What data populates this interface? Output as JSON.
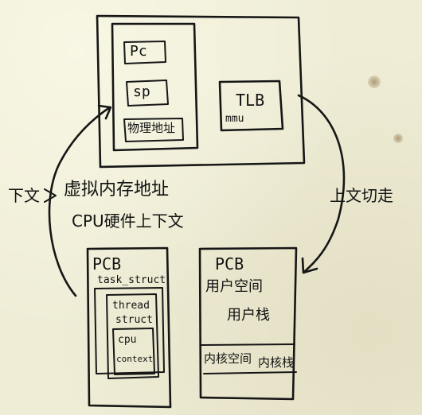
{
  "cpu_box": {
    "register_pc": "Pc",
    "register_sp": "sp",
    "register_phys": "物理地址",
    "tlb": "TLB",
    "mmu": "mmu"
  },
  "left_annotation": {
    "side_label": "下文",
    "line1": "虚拟内存地址",
    "line2": "CPU硬件上下文"
  },
  "right_annotation": {
    "label": "上文切走"
  },
  "pcb_left": {
    "title": "PCB",
    "task_struct": "task_struct",
    "thread_struct_line1": "thread",
    "thread_struct_line2": "struct",
    "cpu_context_line1": "cpu",
    "cpu_context_line2": "context"
  },
  "pcb_right": {
    "title": "PCB",
    "user_space": "用户空间",
    "user_stack": "用户栈",
    "kernel_space": "内核空间",
    "kernel_stack": "内核栈"
  },
  "colors": {
    "ink": "#161616",
    "paper": "#efedd6"
  }
}
